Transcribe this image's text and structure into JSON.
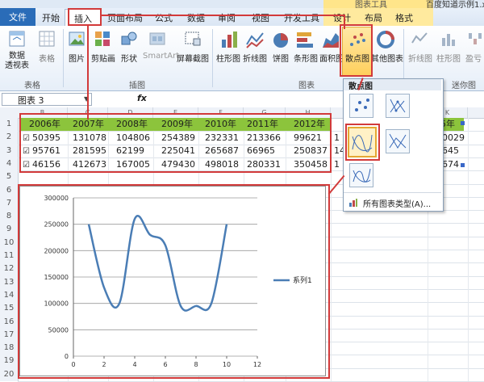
{
  "window": {
    "title": "百度知道示例1.x",
    "context_group": "图表工具"
  },
  "tabs": [
    "文件",
    "开始",
    "插入",
    "页面布局",
    "公式",
    "数据",
    "审阅",
    "视图",
    "开发工具",
    "设计",
    "布局",
    "格式"
  ],
  "ribbon": {
    "buttons": {
      "pivot": "数据\n透视表",
      "table": "表格",
      "picture": "图片",
      "clipart": "剪贴画",
      "shapes": "形状",
      "smartart": "SmartArt",
      "screenshot": "屏幕截图",
      "column": "柱形图",
      "line": "折线图",
      "pie": "饼图",
      "bar": "条形图",
      "area": "面积图",
      "scatter": "散点图",
      "other": "其他图表",
      "spark_line": "折线图",
      "spark_column": "柱形图",
      "spark_winloss": "盈亏"
    },
    "groups": {
      "tables": "表格",
      "illustrations": "插图",
      "charts": "图表",
      "sparklines": "迷你图"
    }
  },
  "namebox": {
    "value": "图表 3"
  },
  "formula": {
    "fx": "fx"
  },
  "columns": [
    "B",
    "C",
    "D",
    "E",
    "F",
    "G",
    "H",
    "K"
  ],
  "rows": [
    "1",
    "2",
    "3",
    "4",
    "5",
    "6",
    "7",
    "8",
    "9",
    "10",
    "11",
    "12",
    "13",
    "14",
    "15",
    "16",
    "17",
    "18",
    "19",
    "20"
  ],
  "sheet": {
    "headers": [
      "2006年",
      "2007年",
      "2008年",
      "2009年",
      "2010年",
      "2011年",
      "2012年",
      "5年"
    ],
    "row2": [
      "50395",
      "131078",
      "104806",
      "254389",
      "232331",
      "213366",
      "99621",
      "0029"
    ],
    "row3": [
      "95761",
      "281595",
      "62199",
      "225041",
      "265687",
      "66965",
      "250837",
      "645"
    ],
    "row4": [
      "46156",
      "412673",
      "167005",
      "479430",
      "498018",
      "280331",
      "350458",
      "674"
    ],
    "row_edge": [
      "1",
      "14"
    ]
  },
  "dropdown": {
    "title": "散点图",
    "all_types": "所有图表类型(A)..."
  },
  "chart_data": {
    "type": "scatter",
    "series": [
      {
        "name": "系列1",
        "x": [
          1,
          2,
          3,
          4,
          5,
          6,
          7,
          8,
          9,
          10
        ],
        "y": [
          250000,
          130000,
          100000,
          260000,
          230000,
          210000,
          95000,
          95000,
          100000,
          250000
        ]
      }
    ],
    "x_ticks": [
      "0",
      "2",
      "4",
      "6",
      "8",
      "10",
      "12"
    ],
    "y_ticks": [
      "0",
      "50000",
      "100000",
      "150000",
      "200000",
      "250000",
      "300000"
    ],
    "xlim": [
      0,
      12
    ],
    "ylim": [
      0,
      300000
    ],
    "line_color": "#4a7db5",
    "legend_position": "right",
    "smooth": true
  }
}
